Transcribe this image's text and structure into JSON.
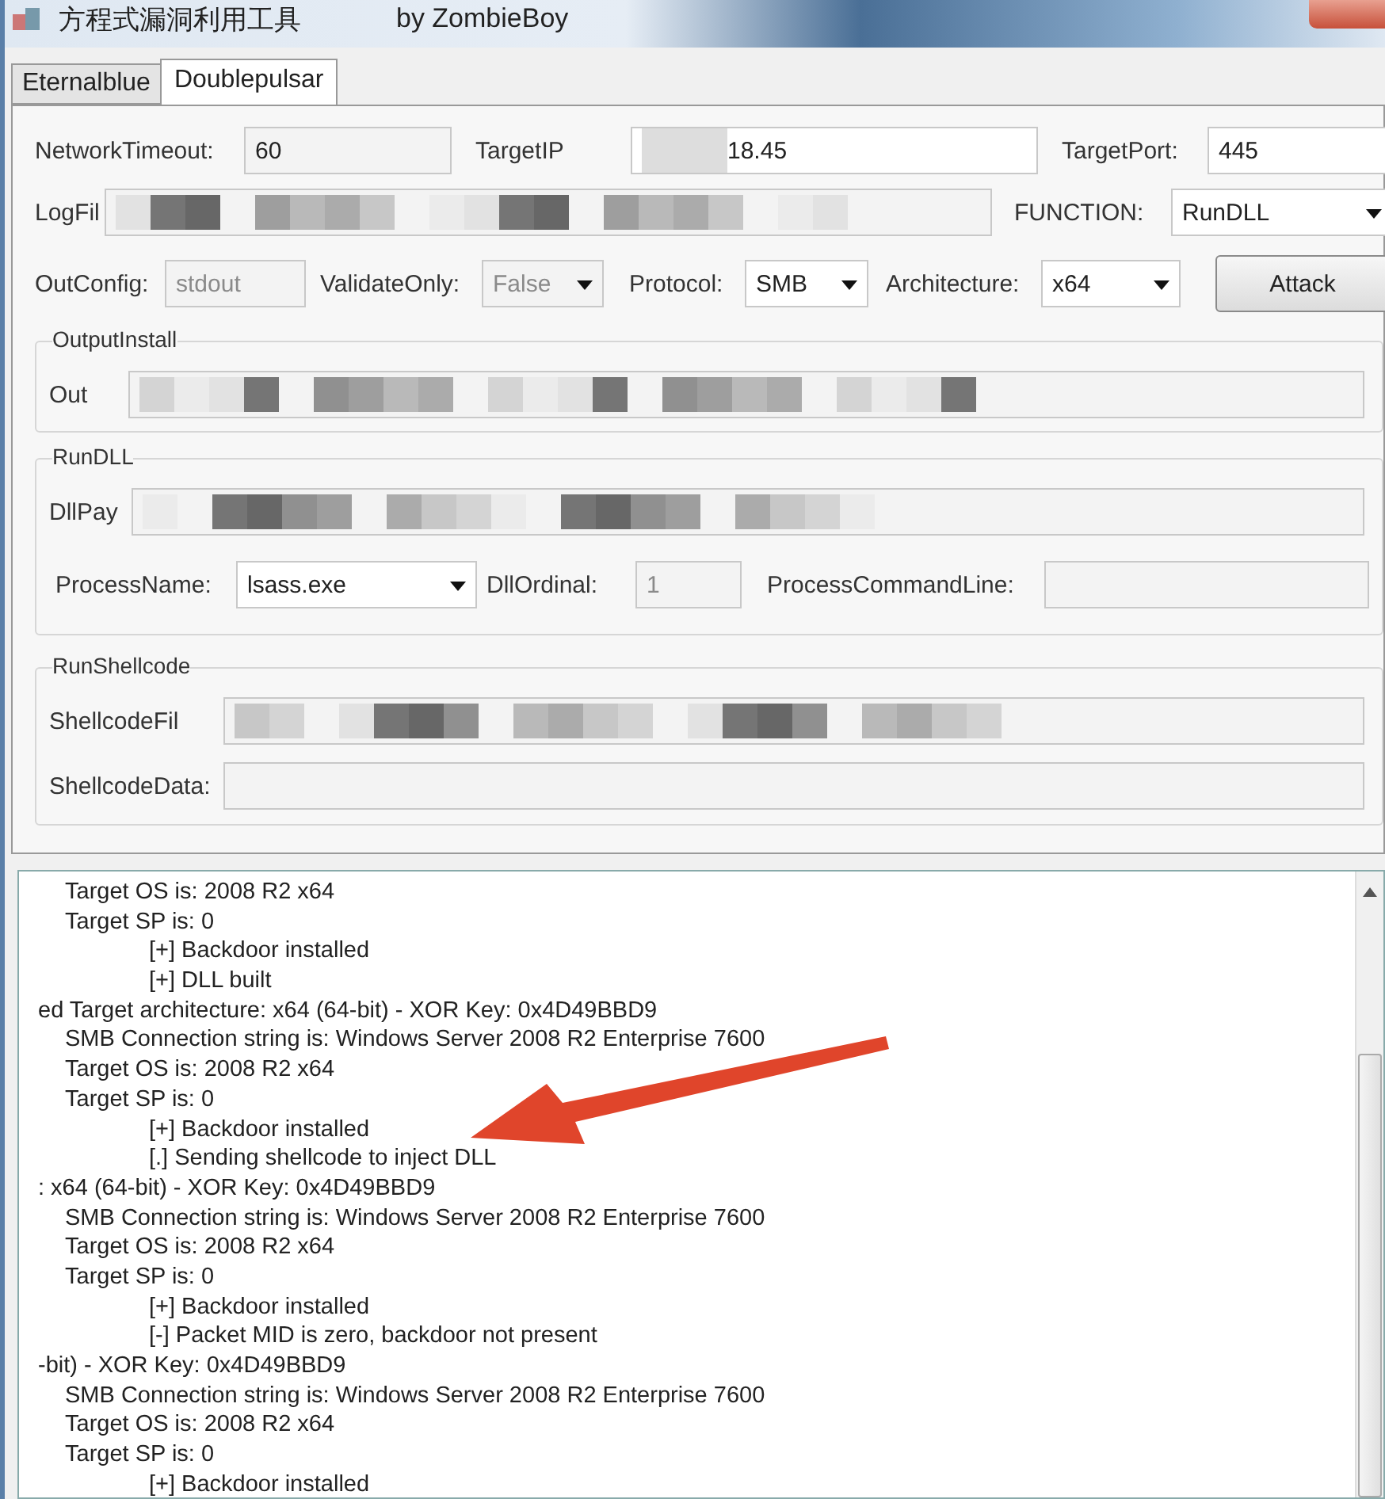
{
  "window": {
    "title": "方程式漏洞利用工具",
    "subtitle": "by ZombieBoy"
  },
  "tabs": [
    {
      "label": "Eternalblue",
      "selected": false
    },
    {
      "label": "Doublepulsar",
      "selected": true
    }
  ],
  "settings": {
    "network_timeout": {
      "label": "NetworkTimeout:",
      "value": "60"
    },
    "target_ip": {
      "label": "TargetIP",
      "value": "18.45"
    },
    "target_port": {
      "label": "TargetPort:",
      "value": "445"
    },
    "log_file": {
      "label": "LogFil"
    },
    "function": {
      "label": "FUNCTION:",
      "value": "RunDLL"
    },
    "out_config": {
      "label": "OutConfig:",
      "value": "stdout",
      "disabled": true
    },
    "validate_only": {
      "label": "ValidateOnly:",
      "value": "False",
      "disabled": true
    },
    "protocol": {
      "label": "Protocol:",
      "value": "SMB"
    },
    "architecture": {
      "label": "Architecture:",
      "value": "x64"
    },
    "attack_button": "Attack"
  },
  "output_install": {
    "title": "OutputInstall",
    "label": "Out"
  },
  "run_dll": {
    "title": "RunDLL",
    "payload_label": "DllPay",
    "process_name": {
      "label": "ProcessName:",
      "value": "lsass.exe"
    },
    "dll_ordinal": {
      "label": "DllOrdinal:",
      "value": "1",
      "disabled": true
    },
    "command_line": {
      "label": "ProcessCommandLine:"
    }
  },
  "run_shellcode": {
    "title": "RunShellcode",
    "file_label": "ShellcodeFil",
    "data_label": "ShellcodeData:"
  },
  "log": [
    {
      "kind": "detail",
      "text": "Target OS is: 2008 R2 x64"
    },
    {
      "kind": "detail",
      "text": "Target SP is: 0"
    },
    {
      "kind": "status",
      "text": "[+] Backdoor installed"
    },
    {
      "kind": "status",
      "text": "[+] DLL built"
    },
    {
      "kind": "cut",
      "text": "ed Target architecture: x64 (64-bit) - XOR Key: 0x4D49BBD9"
    },
    {
      "kind": "detail",
      "text": "SMB Connection string is: Windows Server 2008 R2 Enterprise 7600"
    },
    {
      "kind": "detail",
      "text": "Target OS is: 2008 R2 x64"
    },
    {
      "kind": "detail",
      "text": "Target SP is: 0"
    },
    {
      "kind": "status",
      "text": "[+] Backdoor installed"
    },
    {
      "kind": "status",
      "text": "[.] Sending shellcode to inject DLL"
    },
    {
      "kind": "cut",
      "text": ": x64 (64-bit) - XOR Key: 0x4D49BBD9"
    },
    {
      "kind": "detail",
      "text": "SMB Connection string is: Windows Server 2008 R2 Enterprise 7600"
    },
    {
      "kind": "detail",
      "text": "Target OS is: 2008 R2 x64"
    },
    {
      "kind": "detail",
      "text": "Target SP is: 0"
    },
    {
      "kind": "status",
      "text": "[+] Backdoor installed"
    },
    {
      "kind": "status",
      "text": "[-] Packet MID is zero, backdoor not present"
    },
    {
      "kind": "cut",
      "text": "-bit) - XOR Key: 0x4D49BBD9"
    },
    {
      "kind": "detail",
      "text": "SMB Connection string is: Windows Server 2008 R2 Enterprise 7600"
    },
    {
      "kind": "detail",
      "text": "Target OS is: 2008 R2 x64"
    },
    {
      "kind": "detail",
      "text": "Target SP is: 0"
    },
    {
      "kind": "status",
      "text": "[+] Backdoor installed"
    }
  ]
}
